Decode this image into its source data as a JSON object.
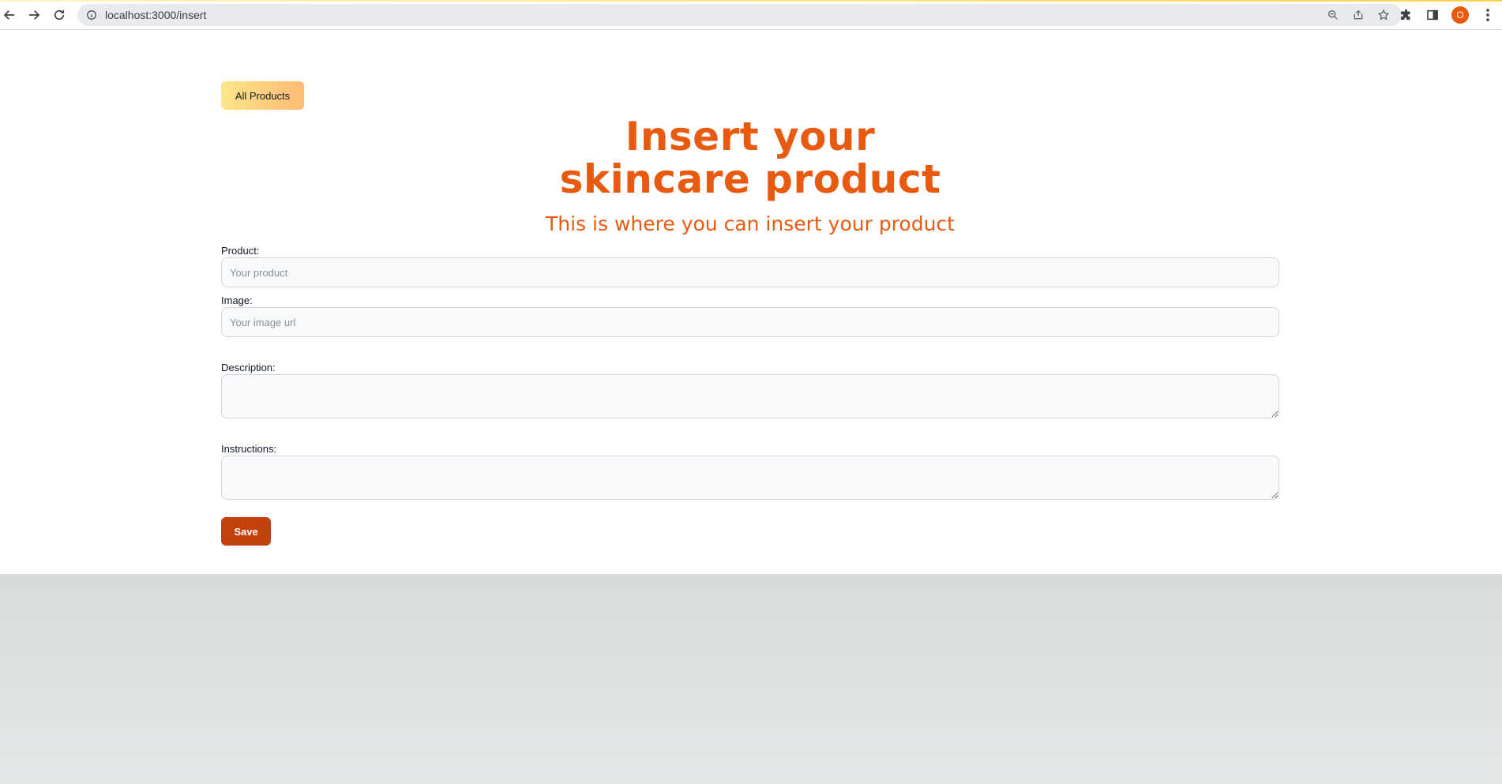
{
  "browser": {
    "url": "localhost:3000/insert",
    "profile_initial": "O",
    "icons": {
      "back": "arrow-left-icon",
      "forward": "arrow-right-icon",
      "reload": "reload-icon",
      "info": "info-icon",
      "zoom": "zoom-icon",
      "share": "share-icon",
      "bookmark": "star-icon",
      "extensions": "puzzle-icon",
      "side_panel": "side-panel-icon",
      "menu": "kebab-menu-icon"
    }
  },
  "nav": {
    "all_products_label": "All Products"
  },
  "header": {
    "title_line1": "Insert your",
    "title_line2": "skincare product",
    "subtitle": "This is where you can insert your product"
  },
  "form": {
    "product": {
      "label": "Product:",
      "value": "",
      "placeholder": "Your product"
    },
    "image": {
      "label": "Image:",
      "value": "",
      "placeholder": "Your image url"
    },
    "description": {
      "label": "Description:",
      "value": ""
    },
    "instructions": {
      "label": "Instructions:",
      "value": ""
    },
    "save_label": "Save"
  },
  "colors": {
    "accent": "#e85a0f",
    "save_button": "#c2410c",
    "all_products_gradient_start": "#fde68a",
    "all_products_gradient_end": "#fdba74",
    "footer_bg": "#d6dbdb"
  }
}
